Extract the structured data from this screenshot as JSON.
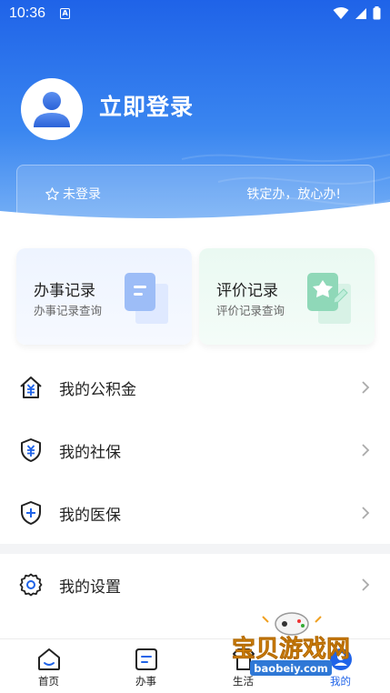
{
  "status_bar": {
    "time": "10:36",
    "notif_glyph": "A"
  },
  "header": {
    "login_title": "立即登录",
    "banner_status": "未登录",
    "banner_slogan": "铁定办，放心办!"
  },
  "cards": [
    {
      "title": "办事记录",
      "subtitle": "办事记录查询",
      "icon": "document-icon"
    },
    {
      "title": "评价记录",
      "subtitle": "评价记录查询",
      "icon": "feedback-icon"
    }
  ],
  "menu": [
    {
      "label": "我的公积金",
      "icon": "house-yuan-icon"
    },
    {
      "label": "我的社保",
      "icon": "shield-yuan-icon"
    },
    {
      "label": "我的医保",
      "icon": "shield-plus-icon"
    },
    {
      "label": "我的设置",
      "icon": "gear-icon"
    }
  ],
  "bottom_nav": [
    {
      "label": "首页",
      "icon": "home-icon"
    },
    {
      "label": "办事",
      "icon": "tasks-icon"
    },
    {
      "label": "生活",
      "icon": "life-icon"
    },
    {
      "label": "我的",
      "icon": "profile-icon",
      "active": true
    }
  ],
  "watermark": {
    "text": "宝贝游戏网",
    "url": "baobeiy.com"
  },
  "colors": {
    "primary": "#1f63e8",
    "header_light": "#7fb6f6",
    "text": "#222222",
    "muted": "#666666"
  }
}
